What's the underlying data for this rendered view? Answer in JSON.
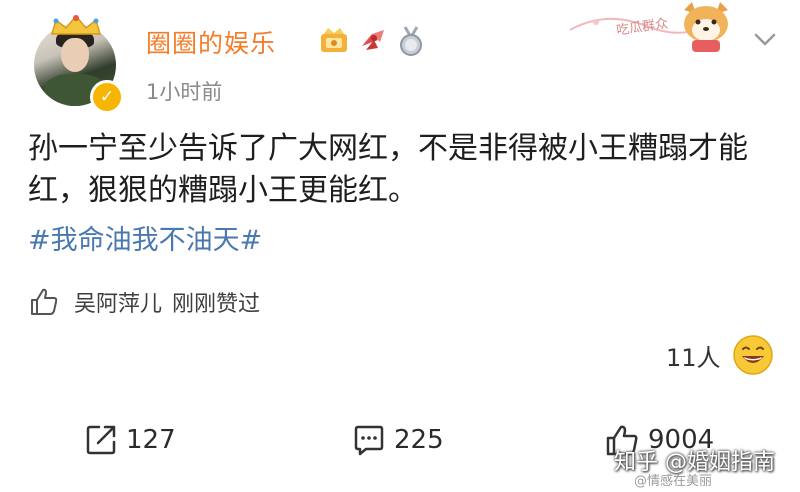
{
  "header": {
    "username": "圈圈的娱乐",
    "timestamp": "1小时前",
    "banner_text": "吃瓜群众",
    "badges": [
      "vip-badge-icon",
      "ribbon-badge-icon",
      "medal-badge-icon"
    ],
    "verify_symbol": "✓",
    "accent_color": "#f57c28"
  },
  "post": {
    "text": "孙一宁至少告诉了广大网红，不是非得被小王糟蹋才能红，狠狠的糟蹋小王更能红。",
    "hashtag": "#我命油我不油天#",
    "hashtag_color": "#4a78b0"
  },
  "liked_by": {
    "name": "吴阿萍儿",
    "note": "刚刚赞过"
  },
  "reactions": {
    "count": "11人",
    "emoji": "grinning-face-icon"
  },
  "actions": {
    "repost_count": "127",
    "comment_count": "225",
    "like_count": "9004"
  },
  "watermarks": {
    "zhihu": "知乎 @婚姻指南",
    "weibo": "@情感在美丽"
  }
}
